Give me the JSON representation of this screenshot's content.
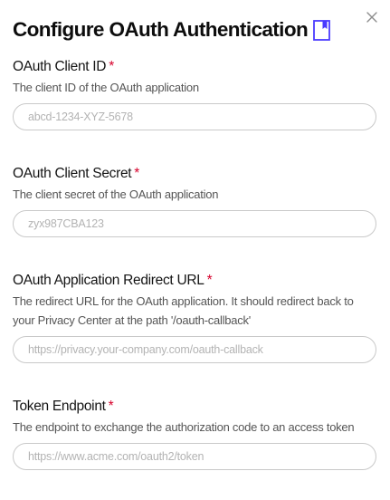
{
  "dialog": {
    "title": "Configure OAuth Authentication",
    "close_symbol": "×"
  },
  "fields": [
    {
      "label": "OAuth Client ID",
      "required_mark": "*",
      "help": "The client ID of the OAuth application",
      "value": "",
      "placeholder": "abcd-1234-XYZ-5678"
    },
    {
      "label": "OAuth Client Secret",
      "required_mark": "*",
      "help": "The client secret of the OAuth application",
      "value": "",
      "placeholder": "zyx987CBA123"
    },
    {
      "label": "OAuth Application Redirect URL",
      "required_mark": "*",
      "help_lines": [
        "The redirect URL for the OAuth application. It should redirect back to",
        "your Privacy Center at the path '/oauth-callback'"
      ],
      "value": "",
      "placeholder": "https://privacy.your-company.com/oauth-callback"
    },
    {
      "label": "Token Endpoint",
      "required_mark": "*",
      "help": "The endpoint to exchange the authorization code to an access token",
      "value": "",
      "placeholder": "https://www.acme.com/oauth2/token"
    }
  ],
  "colors": {
    "accent": "#4a3aff",
    "required": "#d6002b",
    "border": "#c9c9c9"
  },
  "icons": {
    "doc": "book-icon",
    "close": "close-icon"
  }
}
